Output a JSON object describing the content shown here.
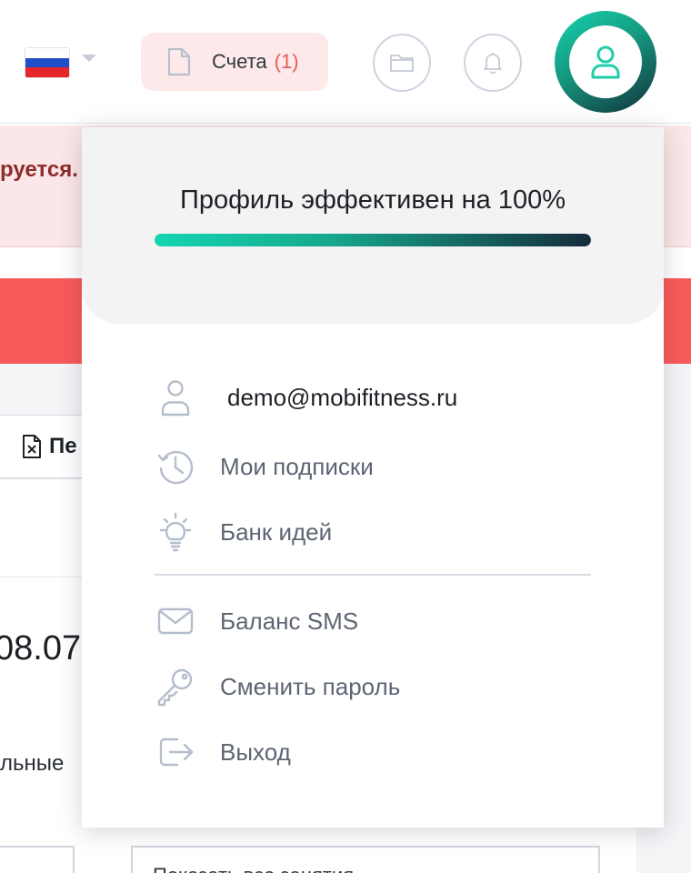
{
  "header": {
    "language_flag": "russia-flag",
    "invoices": {
      "label": "Счета",
      "count": "(1)"
    },
    "icons": [
      "document-icon",
      "folder-icon",
      "bell-icon",
      "user-icon"
    ],
    "accent_color": "#16d3ae",
    "badge_color": "#ea5a5a"
  },
  "background": {
    "warning_text": "руется.",
    "export_label": "Пе",
    "date_text": "08.07",
    "side_text": "льные",
    "select_text": "Показать все занятия"
  },
  "dropdown": {
    "effectiveness_text": "Профиль эффективен на 100%",
    "effectiveness_percent": 100,
    "email": "demo@mobifitness.ru",
    "items": [
      {
        "label": "Мои подписки",
        "icon": "clock-history-icon"
      },
      {
        "label": "Банк идей",
        "icon": "lightbulb-icon"
      },
      {
        "label": "Баланс SMS",
        "icon": "envelope-icon"
      },
      {
        "label": "Сменить пароль",
        "icon": "key-icon"
      },
      {
        "label": "Выход",
        "icon": "logout-icon"
      }
    ]
  }
}
